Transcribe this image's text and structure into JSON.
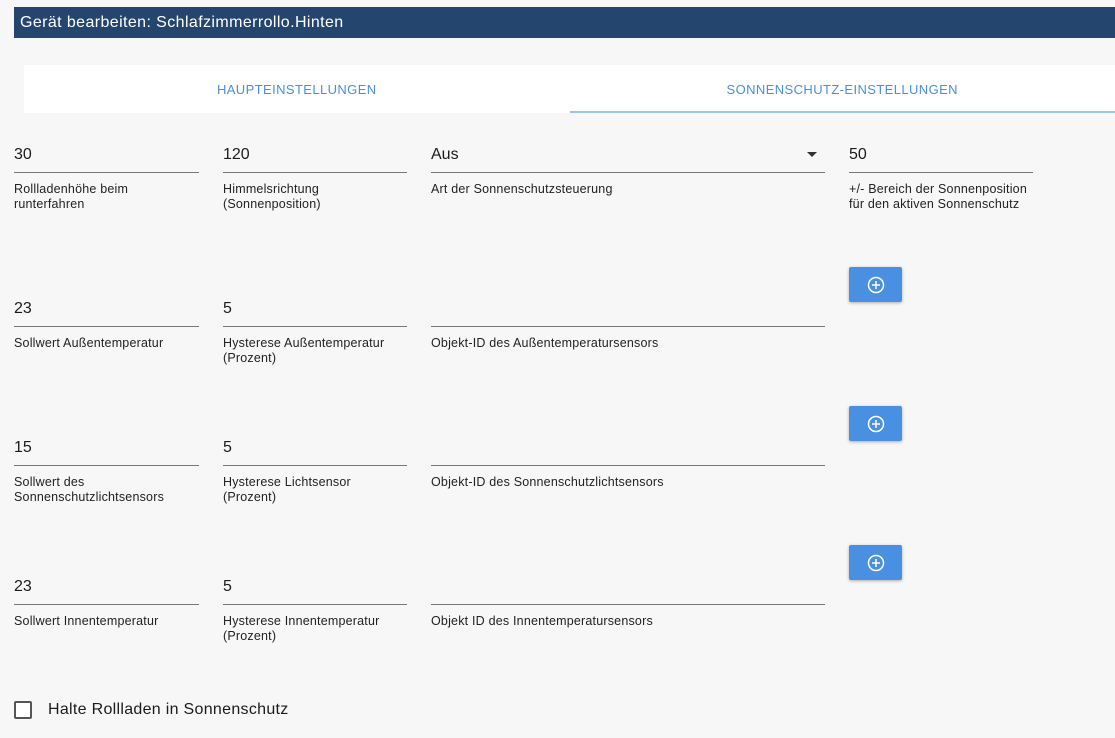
{
  "title": "Gerät bearbeiten: Schlafzimmerrollo.Hinten",
  "tabs": [
    {
      "label": "HAUPTEINSTELLUNGEN",
      "active": false
    },
    {
      "label": "SONNENSCHUTZ-EINSTELLUNGEN",
      "active": true
    }
  ],
  "row1": {
    "height": {
      "value": "30",
      "label": "Rollladenhöhe beim runterfahren"
    },
    "direction": {
      "value": "120",
      "label": "Himmelsrichtung (Sonnenposition)"
    },
    "mode": {
      "value": "Aus",
      "label": "Art der Sonnenschutzsteuerung"
    },
    "range": {
      "value": "50",
      "label": "+/- Bereich der Sonnenposition für den aktiven Sonnenschutz"
    }
  },
  "row2": {
    "setpoint": {
      "value": "23",
      "label": "Sollwert Außentemperatur"
    },
    "hysteresis": {
      "value": "5",
      "label": "Hysterese Außentemperatur (Prozent)"
    },
    "object": {
      "value": "",
      "label": "Objekt-ID des Außentemperatursensors"
    }
  },
  "row3": {
    "setpoint": {
      "value": "15",
      "label": "Sollwert des Sonnenschutzlichtsensors"
    },
    "hysteresis": {
      "value": "5",
      "label": "Hysterese Lichtsensor (Prozent)"
    },
    "object": {
      "value": "",
      "label": "Objekt-ID des Sonnenschutzlichtsensors"
    }
  },
  "row4": {
    "setpoint": {
      "value": "23",
      "label": "Sollwert Innentemperatur"
    },
    "hysteresis": {
      "value": "5",
      "label": "Hysterese Innentemperatur (Prozent)"
    },
    "object": {
      "value": "",
      "label": "Objekt ID des Innentemperatursensors"
    }
  },
  "checkbox": {
    "label": "Halte Rollladen in Sonnenschutz",
    "checked": false
  },
  "icons": {
    "add": "add-circle-icon",
    "dropdown": "caret-down-icon"
  },
  "colors": {
    "header": "#24466e",
    "accent": "#4a90e2"
  }
}
